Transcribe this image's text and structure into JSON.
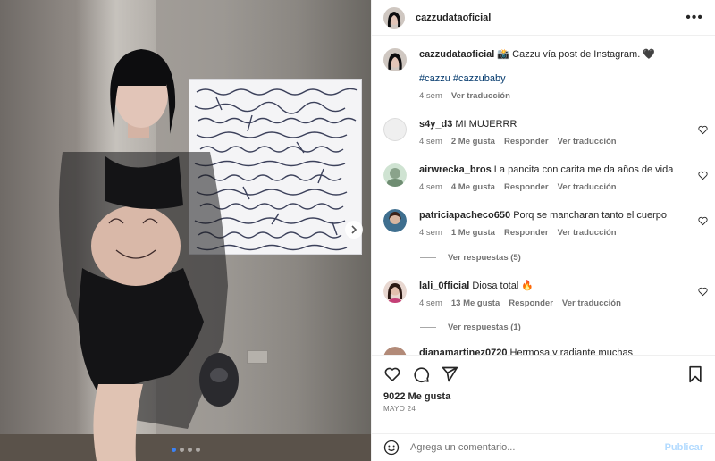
{
  "header": {
    "username": "cazzudataoficial",
    "more_label": "•••"
  },
  "caption": {
    "username": "cazzudataoficial",
    "text": "📸 Cazzu vía post de Instagram. 🖤",
    "hashtags": "#cazzu #cazzubaby",
    "time": "4 sem",
    "translate": "Ver traducción"
  },
  "comments": [
    {
      "username": "s4y_d3",
      "text": "MI MUJERRR",
      "time": "4 sem",
      "likes": "2 Me gusta",
      "reply": "Responder",
      "translate": "Ver traducción"
    },
    {
      "username": "airwrecka_bros",
      "text": "La pancita con carita me da años de vida",
      "time": "4 sem",
      "likes": "4 Me gusta",
      "reply": "Responder",
      "translate": "Ver traducción"
    },
    {
      "username": "patriciapacheco650",
      "text": "Porq se mancharan tanto el cuerpo",
      "time": "4 sem",
      "likes": "1 Me gusta",
      "reply": "Responder",
      "translate": "Ver traducción",
      "view_replies": "Ver respuestas (5)"
    },
    {
      "username": "lali_0fficial",
      "text": "Diosa total 🔥",
      "time": "4 sem",
      "likes": "13 Me gusta",
      "reply": "Responder",
      "translate": "Ver traducción",
      "view_replies": "Ver respuestas (1)"
    },
    {
      "username": "dianamartinez0720",
      "text": "Hermosa y radiante muchas"
    }
  ],
  "actions": {
    "likes": "9022 Me gusta",
    "date": "MAYO 24"
  },
  "add_comment": {
    "placeholder": "Agrega un comentario...",
    "publish": "Publicar"
  },
  "carousel": {
    "total": 4,
    "active": 1
  },
  "colors": {
    "link": "#00376b",
    "muted": "#737373",
    "publish": "#b3dbff",
    "active_dot": "#3b82f6"
  }
}
